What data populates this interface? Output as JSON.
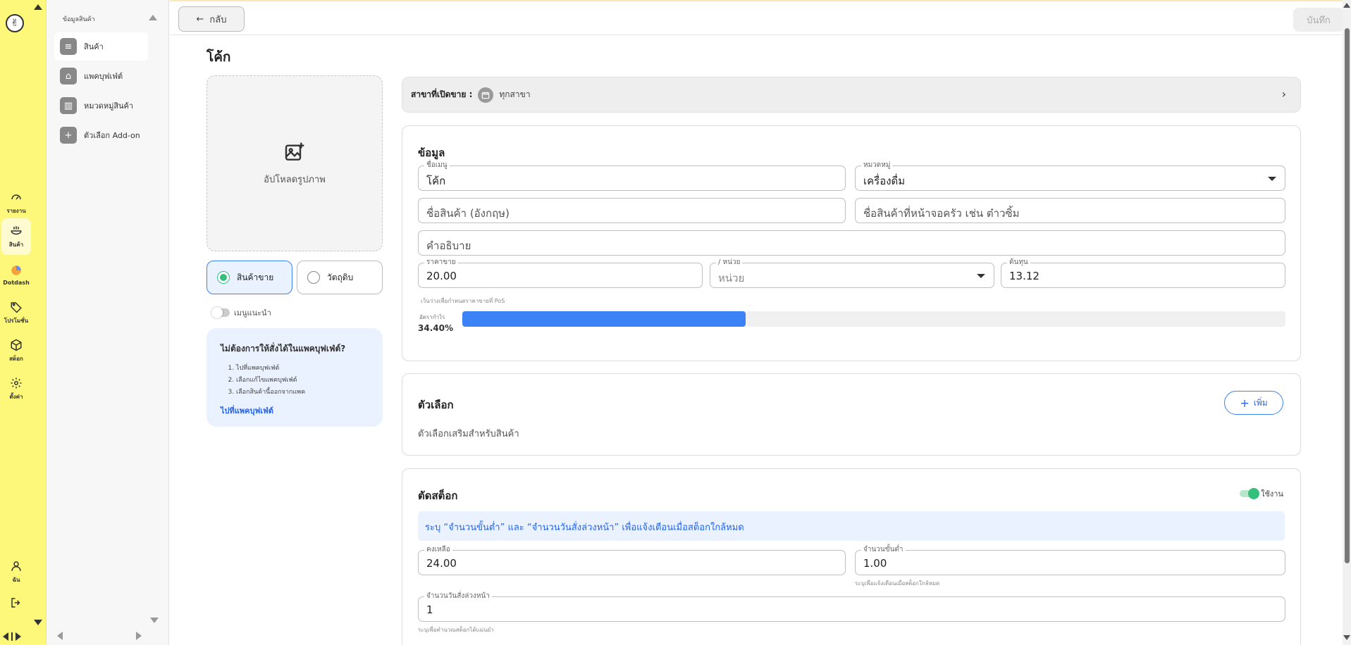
{
  "rail": {
    "items": [
      {
        "label": "รายงาน",
        "icon": "gauge-icon"
      },
      {
        "label": "สินค้า",
        "icon": "food-bowl-icon"
      },
      {
        "label": "Dotdash",
        "icon": "dotdash-icon"
      },
      {
        "label": "โปรโมชั่น",
        "icon": "tag-icon"
      },
      {
        "label": "สต็อก",
        "icon": "box-icon"
      },
      {
        "label": "ตั้งค่า",
        "icon": "gear-icon"
      }
    ],
    "user_label": "ฉัน"
  },
  "subnav": {
    "heading": "ข้อมูลสินค้า",
    "items": [
      {
        "label": "สินค้า",
        "icon": "food-bowl-icon"
      },
      {
        "label": "แพคบุฟเฟ่ต์",
        "icon": "buffet-icon"
      },
      {
        "label": "หมวดหมู่สินค้า",
        "icon": "category-icon"
      },
      {
        "label": "ตัวเลือก Add-on",
        "icon": "plus-icon"
      }
    ]
  },
  "topbar": {
    "back_label": "กลับ",
    "save_label": "บันทึก"
  },
  "page_title": "โค้ก",
  "upload": {
    "label": "อัปโหลดรูปภาพ"
  },
  "product_type": {
    "options": [
      {
        "label": "สินค้าขาย",
        "selected": true
      },
      {
        "label": "วัตถุดิบ",
        "selected": false
      }
    ]
  },
  "recommended_menu": {
    "label": "เมนูแนะนำ",
    "enabled": false
  },
  "buffet_info": {
    "title": "ไม่ต้องการให้สั่งได้ในแพคบุฟเฟ่ต์?",
    "steps": [
      "ไปที่แพคบุฟเฟ่ต์",
      "เลือกแก้ไขแพคบุฟเฟ่ต์",
      "เลือกสินค้านี้ออกจากแพค"
    ],
    "link": "ไปที่แพคบุฟเฟ่ต์"
  },
  "branch": {
    "label": "สาขาที่เปิดขาย :",
    "value": "ทุกสาขา"
  },
  "info_card": {
    "title": "ข้อมูล",
    "menu_name": {
      "label": "ชื่อเมนู",
      "value": "โค้ก"
    },
    "category": {
      "label": "หมวดหมู่",
      "value": "เครื่องดื่ม"
    },
    "name_en": {
      "placeholder": "ชื่อสินค้า (อังกฤษ)"
    },
    "kitchen_name": {
      "placeholder": "ชื่อสินค้าที่หน้าจอครัว เช่น ต๋าวซิ้ม"
    },
    "description": {
      "placeholder": "คำอธิบาย"
    },
    "price": {
      "label": "ราคาขาย",
      "value": "20.00"
    },
    "unit": {
      "label": "/ หน่วย",
      "placeholder": "หน่วย"
    },
    "cost": {
      "label": "ต้นทุน",
      "value": "13.12"
    },
    "price_hint": "เว้นว่างเพื่อกำหนดราคาขายที่ PoS",
    "profit": {
      "label": "อัตรากำไร",
      "value": "34.40%",
      "fraction": 0.344
    }
  },
  "options_card": {
    "title": "ตัวเลือก",
    "add_label": "เพิ่ม",
    "description": "ตัวเลือกเสริมสำหรับสินค้า"
  },
  "stock_card": {
    "title": "ตัดสต็อก",
    "toggle_label": "ใช้งาน",
    "toggle_on": true,
    "info": "ระบุ “จำนวนขั้นต่ำ” และ “จำนวนวันสั่งล่วงหน้า” เพื่อแจ้งเตือนเมื่อสต็อกใกล้หมด",
    "remaining": {
      "label": "คงเหลือ",
      "value": "24.00"
    },
    "minimum": {
      "label": "จำนวนขั้นต่ำ",
      "value": "1.00",
      "hint": "ระบุเพื่อแจ้งเตือนเมื่อสต็อกใกล้หมด"
    },
    "lead_days": {
      "label": "จำนวนวันสั่งล่วงหน้า",
      "value": "1",
      "hint": "ระบุเพื่อคำนวณสต็อกได้แม่นยำ"
    }
  },
  "colors": {
    "rail_bg": "#fdf77a",
    "accent_blue": "#3b82f6",
    "accent_green": "#34c07a"
  }
}
